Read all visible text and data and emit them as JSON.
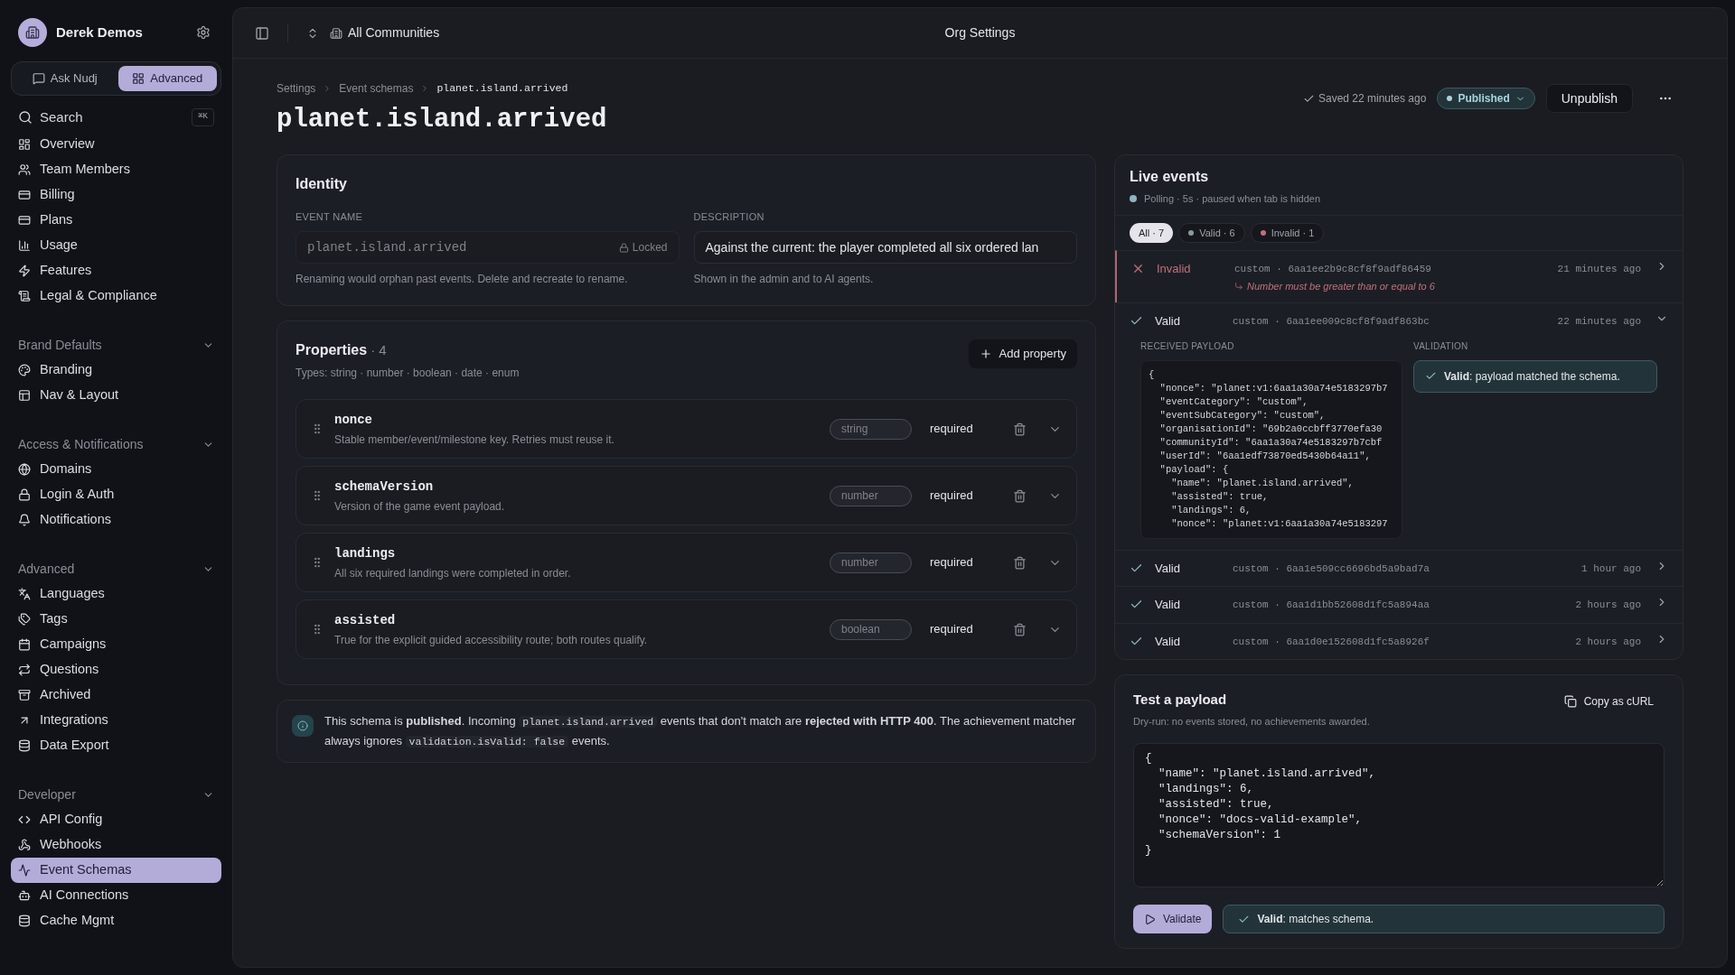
{
  "sidebar": {
    "org_name": "Derek Demos",
    "modes": [
      {
        "label": "Ask Nudj",
        "selected": false
      },
      {
        "label": "Advanced",
        "selected": true
      }
    ],
    "search": {
      "placeholder": "Search",
      "shortcut": "⌘K"
    },
    "groups": [
      {
        "items": [
          {
            "label": "Overview",
            "selected": false
          },
          {
            "label": "Team Members",
            "selected": false
          },
          {
            "label": "Billing",
            "selected": false
          },
          {
            "label": "Plans",
            "selected": false
          },
          {
            "label": "Usage",
            "selected": false
          },
          {
            "label": "Features",
            "selected": false
          },
          {
            "label": "Legal & Compliance",
            "selected": false
          }
        ]
      },
      {
        "title": "Brand Defaults",
        "expanded": true,
        "items": [
          {
            "label": "Branding",
            "selected": false
          },
          {
            "label": "Nav & Layout",
            "selected": false
          }
        ]
      },
      {
        "title": "Access & Notifications",
        "expanded": true,
        "items": [
          {
            "label": "Domains",
            "selected": false
          },
          {
            "label": "Login & Auth",
            "selected": false
          },
          {
            "label": "Notifications",
            "selected": false
          }
        ]
      },
      {
        "title": "Advanced",
        "expanded": true,
        "items": [
          {
            "label": "Languages",
            "selected": false
          },
          {
            "label": "Tags",
            "selected": false
          },
          {
            "label": "Campaigns",
            "selected": false
          },
          {
            "label": "Questions",
            "selected": false
          },
          {
            "label": "Archived",
            "selected": false
          },
          {
            "label": "Integrations",
            "selected": false
          },
          {
            "label": "Data Export",
            "selected": false
          }
        ]
      },
      {
        "title": "Developer",
        "expanded": true,
        "items": [
          {
            "label": "API Config",
            "selected": false
          },
          {
            "label": "Webhooks",
            "selected": false
          },
          {
            "label": "Event Schemas",
            "selected": true
          },
          {
            "label": "AI Connections",
            "selected": false
          },
          {
            "label": "Cache Mgmt",
            "selected": false
          }
        ]
      }
    ]
  },
  "topbar": {
    "community": "All Communities",
    "title": "Org Settings"
  },
  "breadcrumbs": [
    "Settings",
    "Event schemas",
    "planet.island.arrived"
  ],
  "page_title": "planet.island.arrived",
  "status": {
    "saved": "Saved 22 minutes ago",
    "badge": "Published",
    "primary_button": "Unpublish"
  },
  "identity": {
    "title": "Identity",
    "event_name": {
      "label": "EVENT NAME",
      "value": "planet.island.arrived",
      "lock": "Locked",
      "hint": "Renaming would orphan past events. Delete and recreate to rename."
    },
    "description": {
      "label": "DESCRIPTION",
      "value": "Against the current: the player completed all six ordered lan",
      "hint": "Shown in the admin and to AI agents."
    }
  },
  "properties": {
    "title": "Properties",
    "count": "· 4",
    "types": "Types: string · number · boolean · date · enum",
    "add_button": "Add property",
    "items": [
      {
        "name": "nonce",
        "description": "Stable member/event/milestone key. Retries must reuse it.",
        "type": "string",
        "required": "required",
        "expanded": false
      },
      {
        "name": "schemaVersion",
        "description": "Version of the game event payload.",
        "type": "number",
        "required": "required",
        "expanded": false
      },
      {
        "name": "landings",
        "description": "All six required landings were completed in order.",
        "type": "number",
        "required": "required",
        "expanded": false
      },
      {
        "name": "assisted",
        "description": "True for the explicit guided accessibility route; both routes qualify.",
        "type": "boolean",
        "required": "required",
        "expanded": false
      }
    ]
  },
  "notice": [
    {
      "kind": "text",
      "text": "This schema is **published**. Incoming "
    },
    {
      "kind": "code",
      "text": "planet.island.arrived"
    },
    {
      "kind": "text",
      "text": " events that don't match are **rejected with HTTP 400**. The achievement matcher always ignores "
    },
    {
      "kind": "code",
      "text": "validation.isValid: false"
    },
    {
      "kind": "text",
      "text": " events."
    }
  ],
  "live_events": {
    "title": "Live events",
    "polling": "Polling · 5s · paused when tab is hidden",
    "filters": [
      {
        "label": "All · 7",
        "selected": true
      },
      {
        "label": "Valid · 6",
        "selected": false,
        "color": "#8a9aa3"
      },
      {
        "label": "Invalid · 1",
        "selected": false,
        "color": "#c0707a"
      }
    ],
    "events": [
      {
        "kind": "invalid",
        "status": "Invalid",
        "source": "custom · 6aa1ee2b9c8cf8f9adf86459",
        "error": "Number must be greater than or equal to 6",
        "time": "21 minutes ago",
        "expanded": false
      },
      {
        "kind": "valid",
        "status": "Valid",
        "source": "custom · 6aa1ee009c8cf8f9adf863bc",
        "time": "22 minutes ago",
        "expanded": true,
        "payload_label": "RECEIVED PAYLOAD",
        "payload": [
          "{",
          "  \"nonce\": \"planet:v1:6aa1a30a74e5183297b7",
          "  \"eventCategory\": \"custom\",",
          "  \"eventSubCategory\": \"custom\",",
          "  \"organisationId\": \"69b2a0ccbff3770efa30",
          "  \"communityId\": \"6aa1a30a74e5183297b7cbf",
          "  \"userId\": \"6aa1edf73870ed5430b64a11\",",
          "  \"payload\": {",
          "    \"name\": \"planet.island.arrived\",",
          "    \"assisted\": true,",
          "    \"landings\": 6,",
          "    \"nonce\": \"planet:v1:6aa1a30a74e5183297"
        ],
        "validation_label": "VALIDATION",
        "validation": "**Valid**: payload matched the schema."
      },
      {
        "kind": "valid",
        "status": "Valid",
        "source": "custom · 6aa1e509cc6696bd5a9bad7a",
        "time": "1 hour ago",
        "expanded": false
      },
      {
        "kind": "valid",
        "status": "Valid",
        "source": "custom · 6aa1d1bb52608d1fc5a894aa",
        "time": "2 hours ago",
        "expanded": false
      },
      {
        "kind": "valid",
        "status": "Valid",
        "source": "custom · 6aa1d0e152608d1fc5a8926f",
        "time": "2 hours ago",
        "expanded": false
      }
    ]
  },
  "test_payload": {
    "title": "Test a payload",
    "subtitle": "Dry-run: no events stored, no achievements awarded.",
    "copy_button": "Copy as cURL",
    "body": "{\n  \"name\": \"planet.island.arrived\",\n  \"landings\": 6,\n  \"assisted\": true,\n  \"nonce\": \"docs-valid-example\",\n  \"schemaVersion\": 1\n}",
    "validate_button": "Validate",
    "result": "**Valid**: matches schema."
  }
}
